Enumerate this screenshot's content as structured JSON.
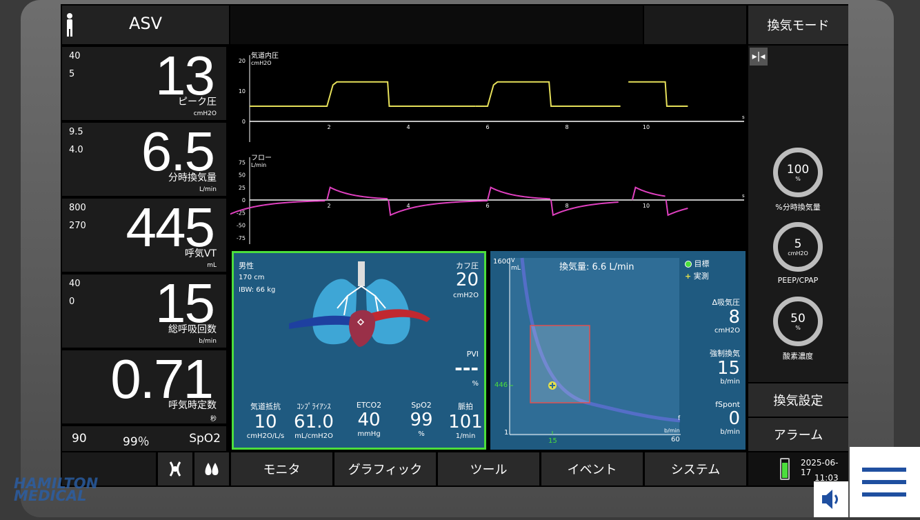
{
  "mode": "ASV",
  "vent_mode_button": "換気モード",
  "params": [
    {
      "hi": "40",
      "lo": "5",
      "value": "13",
      "name": "ピーク圧",
      "unit": "cmH2O"
    },
    {
      "hi": "9.5",
      "lo": "4.0",
      "value": "6.5",
      "name": "分時換気量",
      "unit": "L/min"
    },
    {
      "hi": "800",
      "lo": "270",
      "value": "445",
      "name": "呼気VT",
      "unit": "mL"
    },
    {
      "hi": "40",
      "lo": "0",
      "value": "15",
      "name": "総呼吸回数",
      "unit": "b/min"
    },
    {
      "hi": "",
      "lo": "",
      "value": "0.71",
      "name": "呼気時定数",
      "unit": "秒"
    }
  ],
  "spo2_row": {
    "pulse": "90",
    "spo2": "99％",
    "label": "SpO2"
  },
  "waveforms": {
    "pressure": {
      "title": "気道内圧",
      "unit": "cmH2O",
      "y_ticks": [
        "20",
        "10",
        "0"
      ],
      "x_ticks": [
        "2",
        "4",
        "6",
        "8",
        "10"
      ],
      "x_unit": "s",
      "color": "#e6e05a"
    },
    "flow": {
      "title": "フロー",
      "unit": "L/min",
      "y_ticks": [
        "75",
        "50",
        "25",
        "0",
        "-25",
        "-50",
        "-75"
      ],
      "x_ticks": [
        "2",
        "4",
        "6",
        "8",
        "10"
      ],
      "x_unit": "s",
      "color": "#e040c0"
    }
  },
  "patient": {
    "sex": "男性",
    "height": "170 cm",
    "ibw": "IBW:  66 kg",
    "cuff_label": "カフ圧",
    "cuff_value": "20",
    "cuff_unit": "cmH2O",
    "pvi_label": "PVI",
    "pvi_value": "---",
    "pvi_unit": "%",
    "metrics": [
      {
        "label": "気道抵抗",
        "value": "10",
        "unit": "cmH2O/L/s"
      },
      {
        "label": "ｺﾝﾌﾟﾗｲｱﾝｽ",
        "value": "61.0",
        "unit": "mL/cmH2O"
      },
      {
        "label": "ETCO2",
        "value": "40",
        "unit": "mmHg"
      },
      {
        "label": "SpO2",
        "value": "99",
        "unit": "%"
      },
      {
        "label": "脈拍",
        "value": "101",
        "unit": "1/min"
      }
    ]
  },
  "asv_graph": {
    "title": "換気量: 6.6 L/min",
    "y_top": "1600",
    "y_unit_v": "V",
    "y_unit": "mL",
    "y_bottom": "1",
    "y_marker": "446",
    "x_marker": "15",
    "x_right": "60",
    "x_unit": "b/min",
    "x_label_f": "f",
    "legend_target": "目標",
    "legend_actual": "実測",
    "side": [
      {
        "label": "Δ吸気圧",
        "value": "8",
        "unit": "cmH2O"
      },
      {
        "label": "強制換気",
        "value": "15",
        "unit": "b/min"
      },
      {
        "label": "fSpont",
        "value": "0",
        "unit": "b/min"
      }
    ]
  },
  "controls": [
    {
      "value": "100",
      "unit": "%",
      "label": "%分時換気量"
    },
    {
      "value": "5",
      "unit": "cmH2O",
      "label": "PEEP/CPAP"
    },
    {
      "value": "50",
      "unit": "%",
      "label": "酸素濃度"
    }
  ],
  "right_buttons": {
    "settings": "換気設定",
    "alarm": "アラーム"
  },
  "nav": [
    "モニタ",
    "グラフィック",
    "ツール",
    "イベント",
    "システム"
  ],
  "date": "2025-06-17",
  "time": "11:03",
  "logo": "HAMILTON MEDICAL",
  "colors": {
    "accent_green": "#4cde3c",
    "panel_blue": "#1f5a80"
  }
}
